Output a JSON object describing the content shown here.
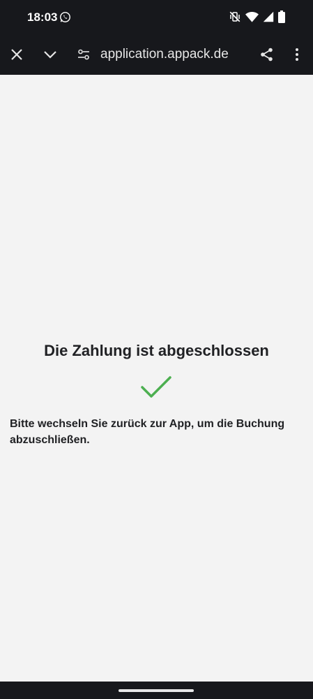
{
  "statusbar": {
    "time": "18:03",
    "icons": [
      "whatsapp-icon",
      "mute-vibrate-icon",
      "wifi-icon",
      "cell-signal-icon",
      "battery-icon"
    ]
  },
  "toolbar": {
    "url": "application.appack.de",
    "icons": [
      "close-icon",
      "chevron-down-icon",
      "site-settings-icon",
      "share-icon",
      "more-vert-icon"
    ]
  },
  "page": {
    "title": "Die Zahlung ist abgeschlossen",
    "message": "Bitte wechseln Sie zurück zur App, um die Buchung abzuschließen.",
    "success_color": "#4caf50"
  },
  "colors": {
    "chrome_bg": "#17181c",
    "page_bg": "#f3f3f3"
  }
}
